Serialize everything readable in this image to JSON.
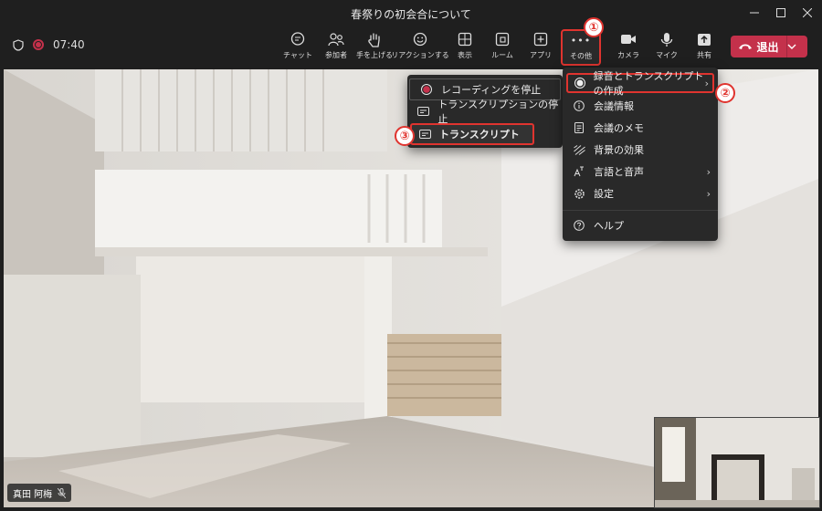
{
  "window": {
    "title": "春祭りの初会合について"
  },
  "toolbar": {
    "timer": "07:40",
    "buttons": [
      {
        "label": "チャット",
        "icon": "chat-icon"
      },
      {
        "label": "参加者",
        "icon": "people-icon"
      },
      {
        "label": "手を上げる",
        "icon": "raise-hand-icon"
      },
      {
        "label": "リアクションする",
        "icon": "smiley-icon"
      },
      {
        "label": "表示",
        "icon": "grid-icon"
      },
      {
        "label": "ルーム",
        "icon": "breakout-rooms-icon"
      },
      {
        "label": "アプリ",
        "icon": "add-app-icon"
      },
      {
        "label": "その他",
        "icon": "more-dots-icon"
      },
      {
        "label": "カメラ",
        "icon": "camera-icon"
      },
      {
        "label": "マイク",
        "icon": "microphone-icon"
      },
      {
        "label": "共有",
        "icon": "share-icon"
      }
    ],
    "more_dots": "•••",
    "leave_label": "退出"
  },
  "more_menu": {
    "items": [
      {
        "label": "録音とトランスクリプトの作成",
        "icon": "record-icon",
        "has_submenu": true
      },
      {
        "label": "会議情報",
        "icon": "info-icon",
        "has_submenu": false
      },
      {
        "label": "会議のメモ",
        "icon": "notes-icon",
        "has_submenu": false
      },
      {
        "label": "背景の効果",
        "icon": "background-effects-icon",
        "has_submenu": false
      },
      {
        "label": "言語と音声",
        "icon": "language-icon",
        "has_submenu": true
      },
      {
        "label": "設定",
        "icon": "gear-icon",
        "has_submenu": true
      },
      {
        "label": "ヘルプ",
        "icon": "help-icon",
        "has_submenu": false
      }
    ]
  },
  "recording_submenu": {
    "items": [
      {
        "label": "レコーディングを停止",
        "icon": "stop-recording-icon"
      },
      {
        "label": "トランスクリプションの停止",
        "icon": "transcript-icon"
      },
      {
        "label": "トランスクリプト",
        "icon": "transcript-icon"
      }
    ]
  },
  "participant": {
    "name": "真田 阿梅"
  },
  "annotations": {
    "step1": "①",
    "step2": "②",
    "step3": "③"
  },
  "colors": {
    "accent_red": "#e0342f",
    "leave_red": "#c4314b",
    "toolbar_bg": "#1f1f1f",
    "menu_bg": "#292929"
  }
}
